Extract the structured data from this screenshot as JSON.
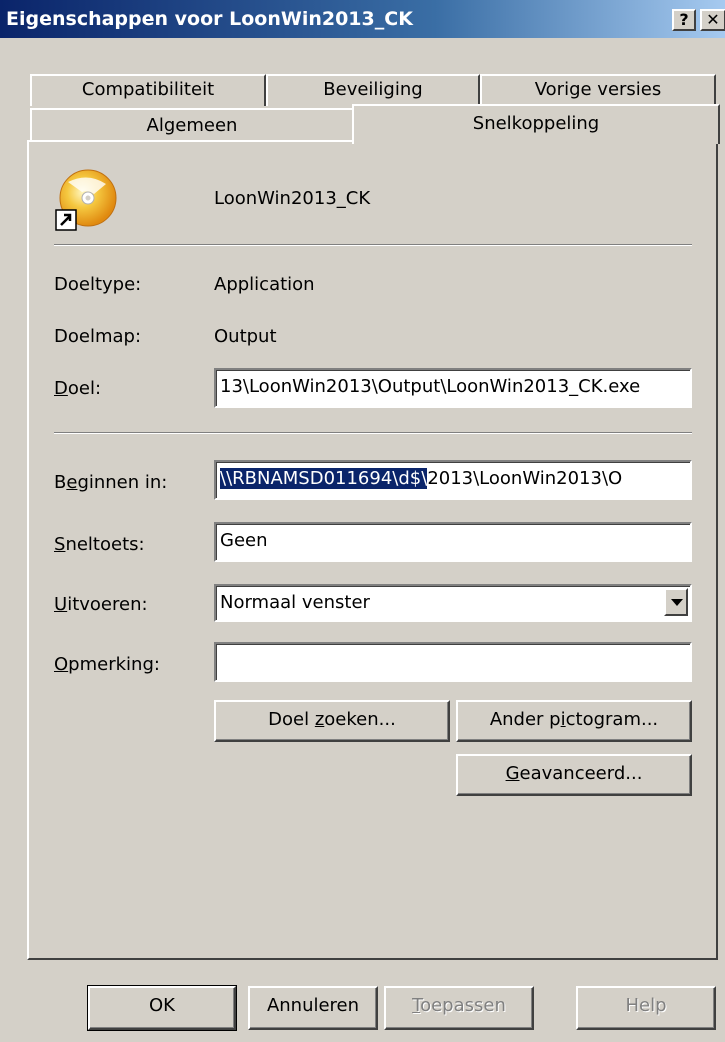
{
  "window": {
    "title": "Eigenschappen voor LoonWin2013_CK",
    "help_btn": "?",
    "close_btn": "✕"
  },
  "tabs": {
    "row1": [
      "Compatibiliteit",
      "Beveiliging",
      "Vorige versies"
    ],
    "row2": [
      "Algemeen",
      "Snelkoppeling"
    ],
    "active": "Snelkoppeling"
  },
  "shortcut": {
    "name": "LoonWin2013_CK",
    "icon": "cd-disc-shortcut-icon"
  },
  "fields": {
    "doeltype": {
      "label": "Doeltype:",
      "value": "Application"
    },
    "doelmap": {
      "label": "Doelmap:",
      "value": "Output"
    },
    "doel": {
      "label_u": "D",
      "label_rest": "oel:",
      "value": "13\\LoonWin2013\\Output\\LoonWin2013_CK.exe"
    },
    "beginnen": {
      "label_pre": "B",
      "label_u": "e",
      "label_rest": "ginnen in:",
      "value_selected": "\\\\RBNAMSD011694\\d$\\",
      "value_rest": "2013\\LoonWin2013\\O"
    },
    "sneltoets": {
      "label_u": "S",
      "label_rest": "neltoets:",
      "value": "Geen"
    },
    "uitvoeren": {
      "label_u": "U",
      "label_rest": "itvoeren:",
      "value": "Normaal venster"
    },
    "opmerking": {
      "label_u": "O",
      "label_rest": "pmerking:",
      "value": ""
    }
  },
  "buttons": {
    "doel_zoeken": {
      "pre": "Doel ",
      "u": "z",
      "rest": "oeken..."
    },
    "ander_pictogram": {
      "pre": "Ander p",
      "u": "i",
      "rest": "ctogram..."
    },
    "geavanceerd": {
      "pre": "",
      "u": "G",
      "rest": "eavanceerd..."
    },
    "ok": "OK",
    "annuleren": "Annuleren",
    "toepassen": {
      "u": "T",
      "rest": "oepassen"
    },
    "help": "Help"
  },
  "colors": {
    "title_bar": "#0a246a",
    "face": "#d4d0c8",
    "selection": "#0a246a"
  }
}
